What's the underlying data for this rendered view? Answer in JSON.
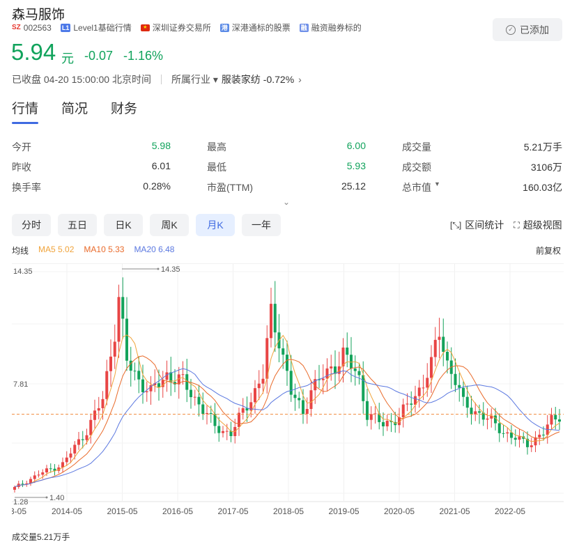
{
  "stock": {
    "name": "森马服饰",
    "market_badge": "SZ",
    "code": "002563",
    "tags": [
      {
        "badge": "L1",
        "label": "Level1基础行情"
      },
      {
        "badge": "",
        "label": "深圳证券交易所"
      },
      {
        "badge": "港",
        "label": "深港通标的股票"
      },
      {
        "badge": "融",
        "label": "融资融券标的"
      }
    ],
    "add_button": "已添加",
    "price": "5.94",
    "unit": "元",
    "change": "-0.07",
    "change_pct": "-1.16%",
    "status": "已收盘 04-20 15:00:00 北京时间",
    "industry_label": "所属行业",
    "industry_name": "服装家纺",
    "industry_change": "-0.72%"
  },
  "tabs": [
    "行情",
    "简况",
    "财务"
  ],
  "quote": [
    [
      {
        "k": "今开",
        "v": "5.98",
        "green": true
      },
      {
        "k": "最高",
        "v": "6.00",
        "green": true
      },
      {
        "k": "成交量",
        "v": "5.21万手",
        "green": false
      }
    ],
    [
      {
        "k": "昨收",
        "v": "6.01",
        "green": false
      },
      {
        "k": "最低",
        "v": "5.93",
        "green": true
      },
      {
        "k": "成交额",
        "v": "3106万",
        "green": false
      }
    ],
    [
      {
        "k": "换手率",
        "v": "0.28%",
        "green": false
      },
      {
        "k": "市盈(TTM)",
        "v": "25.12",
        "green": false
      },
      {
        "k": "总市值",
        "v": "160.03亿",
        "green": false
      }
    ]
  ],
  "periods": [
    "分时",
    "五日",
    "日K",
    "周K",
    "月K",
    "一年"
  ],
  "selected_period": "月K",
  "tools": [
    "区间统计",
    "超级视图"
  ],
  "ma": {
    "label": "均线",
    "ma5": "MA5 5.02",
    "ma10": "MA10 5.33",
    "ma20": "MA20 6.48",
    "colors": {
      "ma5": "#f0a33a",
      "ma10": "#e96a2a",
      "ma20": "#5b78e0"
    }
  },
  "adjust": "前复权",
  "volume_label": "成交量5.21万手",
  "chart_data": {
    "type": "candlestick",
    "y_ticks": [
      "14.35",
      "7.81",
      "1.28"
    ],
    "ylim": [
      1.28,
      14.35
    ],
    "x_tick_labels": [
      "3-05",
      "2014-05",
      "2015-05",
      "2016-05",
      "2017-05",
      "2018-05",
      "2019-05",
      "2020-05",
      "2021-05",
      "2022-05"
    ],
    "high_label": "14.35",
    "low_label": "1.40",
    "current_price": 5.94,
    "colors": {
      "up": "#e84545",
      "down": "#14a35b",
      "current_line": "#f08a3c"
    }
  }
}
